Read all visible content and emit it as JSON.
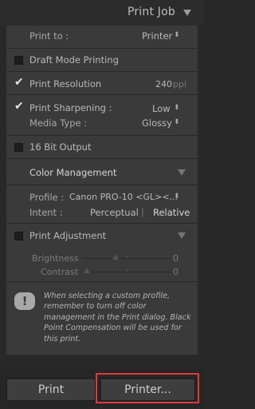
{
  "header": {
    "title": "Print Job"
  },
  "print_to": {
    "label": "Print to :",
    "value": "Printer"
  },
  "draft_mode": {
    "label": "Draft Mode Printing",
    "checked": false
  },
  "print_resolution": {
    "label": "Print Resolution",
    "checked": true,
    "value": "240",
    "unit": "ppi"
  },
  "print_sharpening": {
    "label": "Print Sharpening :",
    "checked": true,
    "value": "Low"
  },
  "media_type": {
    "label": "Media Type :",
    "value": "Glossy"
  },
  "bit_output": {
    "label": "16 Bit Output",
    "checked": false
  },
  "color_management": {
    "title": "Color Management",
    "profile_label": "Profile :",
    "profile_value": "Canon PRO-10 <GL><...",
    "intent_label": "Intent :",
    "intent_options": [
      "Perceptual",
      "Relative"
    ],
    "intent_selected": "Relative",
    "divider": "|"
  },
  "print_adjustment": {
    "label": "Print Adjustment",
    "checked": false,
    "brightness_label": "Brightness",
    "brightness_value": "0",
    "contrast_label": "Contrast",
    "contrast_value": "0"
  },
  "warning": {
    "icon_glyph": "!",
    "text": "When selecting a custom profile, remember to turn off color management in the Print dialog. Black Point Compensation will be used for this print."
  },
  "buttons": {
    "print_label": "Print",
    "printer_label": "Printer..."
  },
  "glyphs": {
    "check": "✔",
    "updown": "⬍"
  }
}
